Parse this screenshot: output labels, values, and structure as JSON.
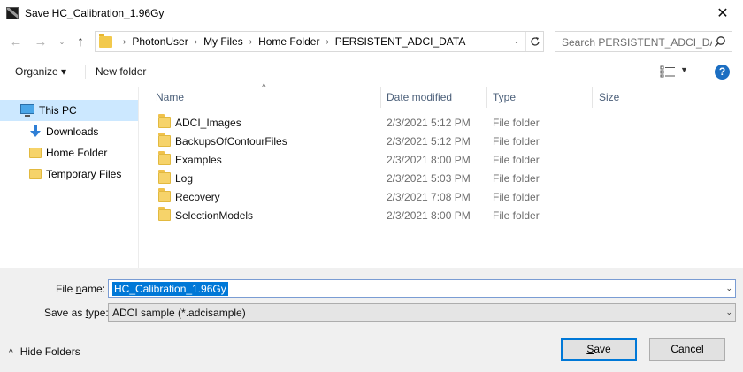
{
  "window": {
    "title": "Save HC_Calibration_1.96Gy",
    "close_glyph": "✕"
  },
  "nav": {
    "back_glyph": "←",
    "forward_glyph": "→",
    "recent_glyph": "⌄",
    "up_glyph": "↑"
  },
  "address": {
    "crumbs": [
      "PhotonUser",
      "My Files",
      "Home Folder",
      "PERSISTENT_ADCI_DATA"
    ],
    "separator": "›"
  },
  "search": {
    "placeholder": "Search PERSISTENT_ADCI_DA..."
  },
  "toolbar": {
    "organize_label": "Organize ▾",
    "new_folder_label": "New folder",
    "view_dropdown": "▼",
    "help_label": "?"
  },
  "navpane": {
    "items": [
      {
        "label": "This PC",
        "icon": "computer-icon"
      },
      {
        "label": "Downloads",
        "icon": "downloads-icon"
      },
      {
        "label": "Home Folder",
        "icon": "folder-icon"
      },
      {
        "label": "Temporary Files",
        "icon": "folder-icon"
      }
    ]
  },
  "filelist": {
    "columns": {
      "name": "Name",
      "date": "Date modified",
      "type": "Type",
      "size": "Size"
    },
    "sort_glyph": "^",
    "rows": [
      {
        "name": "ADCI_Images",
        "date": "2/3/2021 5:12 PM",
        "type": "File folder"
      },
      {
        "name": "BackupsOfContourFiles",
        "date": "2/3/2021 5:12 PM",
        "type": "File folder"
      },
      {
        "name": "Examples",
        "date": "2/3/2021 8:00 PM",
        "type": "File folder"
      },
      {
        "name": "Log",
        "date": "2/3/2021 5:03 PM",
        "type": "File folder"
      },
      {
        "name": "Recovery",
        "date": "2/3/2021 7:08 PM",
        "type": "File folder"
      },
      {
        "name": "SelectionModels",
        "date": "2/3/2021 8:00 PM",
        "type": "File folder"
      }
    ]
  },
  "form": {
    "file_name_label_pre": "File ",
    "file_name_label_ul": "n",
    "file_name_label_post": "ame:",
    "file_name_value": "HC_Calibration_1.96Gy",
    "save_type_label_pre": "Save as ",
    "save_type_label_ul": "t",
    "save_type_label_post": "ype:",
    "save_type_value": "ADCI sample (*.adcisample)",
    "dropdown_glyph": "⌄"
  },
  "footer": {
    "hide_folders_label": "Hide Folders",
    "hide_folders_glyph": "^",
    "save_label_ul": "S",
    "save_label_rest": "ave",
    "cancel_label": "Cancel"
  },
  "colors": {
    "selection": "#0078d7",
    "nav_selected": "#cce8ff",
    "folder": "#f6d36a",
    "help": "#1b6ec2"
  }
}
